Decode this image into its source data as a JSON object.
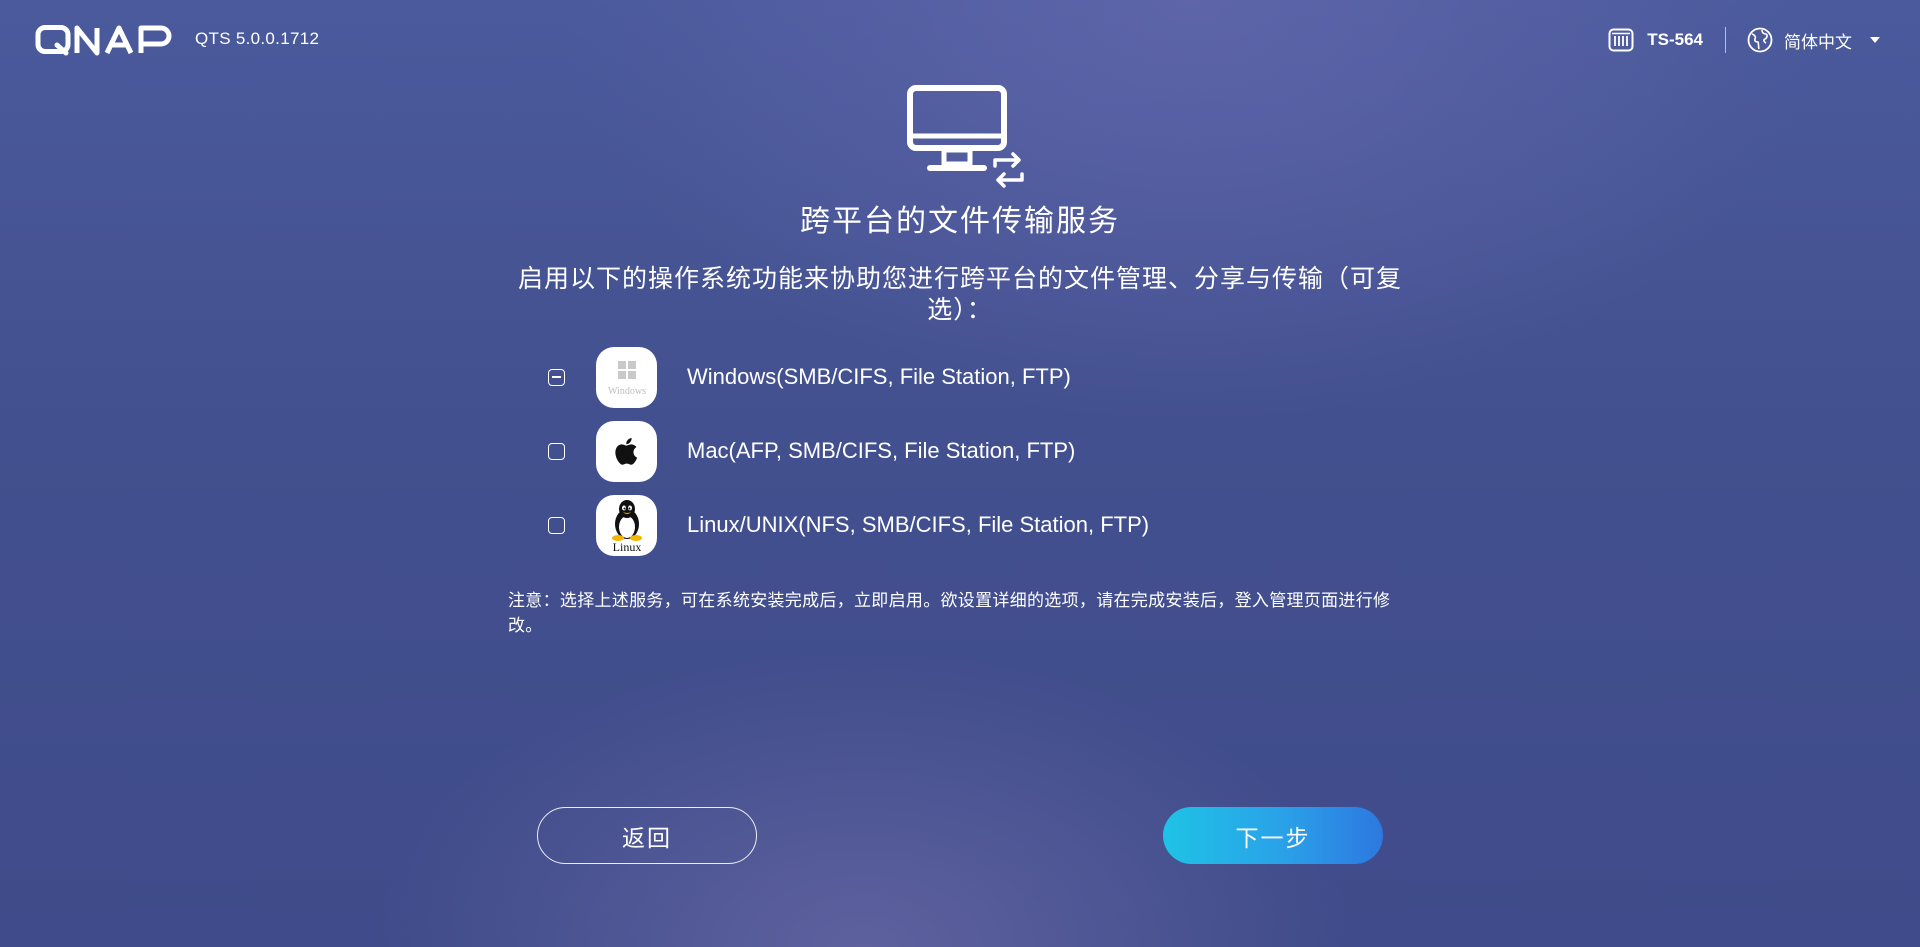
{
  "header": {
    "logo_text": "QNAP",
    "version": "QTS 5.0.0.1712",
    "device_icon": "nas-device-icon",
    "device_name": "TS-564",
    "language_icon": "globe-icon",
    "language": "简体中文",
    "language_dropdown_icon": "caret-down-icon"
  },
  "main": {
    "hero_icon": "monitor-sync-icon",
    "title": "跨平台的文件传输服务",
    "description": "启用以下的操作系统功能来协助您进行跨平台的文件管理、分享与传输（可复选）：",
    "options": [
      {
        "label": "Windows(SMB/CIFS, File Station, FTP)",
        "icon": "windows-icon",
        "icon_text": "Windows",
        "state": "indeterminate"
      },
      {
        "label": "Mac(AFP, SMB/CIFS, File Station, FTP)",
        "icon": "apple-icon",
        "state": "unchecked"
      },
      {
        "label": "Linux/UNIX(NFS, SMB/CIFS, File Station, FTP)",
        "icon": "linux-tux-icon",
        "icon_text": "Linux",
        "state": "unchecked"
      }
    ],
    "note": "注意：选择上述服务，可在系统安装完成后，立即启用。欲设置详细的选项，请在完成安装后，登入管理页面进行修改。"
  },
  "buttons": {
    "back": "返回",
    "next": "下一步"
  },
  "colors": {
    "background_top": "#4a5a9c",
    "background_bottom": "#3f4b8a",
    "next_button_start": "#1ec3e6",
    "next_button_end": "#2d78e0",
    "text": "#ffffff"
  }
}
